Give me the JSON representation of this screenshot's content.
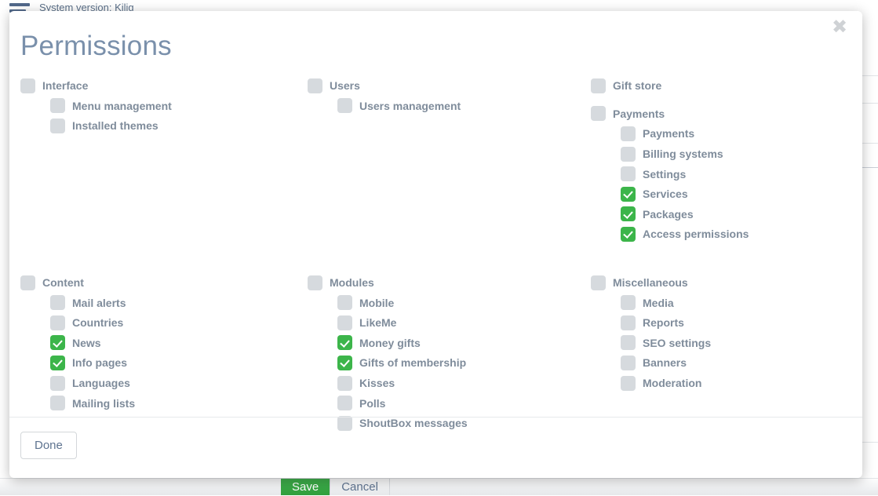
{
  "background": {
    "system_version_text": "System version: Kilig",
    "menu_icon": "hamburger-icon",
    "save_label": "Save",
    "cancel_label": "Cancel"
  },
  "modal": {
    "title": "Permissions",
    "close_icon": "✖",
    "done_label": "Done",
    "accent_checked_color": "#3cb54a",
    "unchecked_color": "#d6dade",
    "label_color": "#7f8c9b",
    "title_color": "#7a90ab",
    "groups": [
      {
        "name": "interface",
        "parent": {
          "label": "Interface",
          "checked": false
        },
        "children": [
          {
            "label": "Menu management",
            "checked": false
          },
          {
            "label": "Installed themes",
            "checked": false
          }
        ]
      },
      {
        "name": "users",
        "parent": {
          "label": "Users",
          "checked": false
        },
        "children": [
          {
            "label": "Users management",
            "checked": false
          }
        ]
      },
      {
        "name": "gift-store-and-payments",
        "parent": {
          "label": "Gift store",
          "checked": false
        },
        "secondary_parent": {
          "label": "Payments",
          "checked": false
        },
        "children": [
          {
            "label": "Payments",
            "checked": false
          },
          {
            "label": "Billing systems",
            "checked": false
          },
          {
            "label": "Settings",
            "checked": false
          },
          {
            "label": "Services",
            "checked": true
          },
          {
            "label": "Packages",
            "checked": true
          },
          {
            "label": "Access permissions",
            "checked": true
          }
        ]
      },
      {
        "name": "content",
        "parent": {
          "label": "Content",
          "checked": false
        },
        "children": [
          {
            "label": "Mail alerts",
            "checked": false
          },
          {
            "label": "Countries",
            "checked": false
          },
          {
            "label": "News",
            "checked": true
          },
          {
            "label": "Info pages",
            "checked": true
          },
          {
            "label": "Languages",
            "checked": false
          },
          {
            "label": "Mailing lists",
            "checked": false
          }
        ]
      },
      {
        "name": "modules",
        "parent": {
          "label": "Modules",
          "checked": false
        },
        "children": [
          {
            "label": "Mobile",
            "checked": false
          },
          {
            "label": "LikeMe",
            "checked": false
          },
          {
            "label": "Money gifts",
            "checked": true
          },
          {
            "label": "Gifts of membership",
            "checked": true
          },
          {
            "label": "Kisses",
            "checked": false
          },
          {
            "label": "Polls",
            "checked": false
          },
          {
            "label": "ShoutBox messages",
            "checked": false
          }
        ]
      },
      {
        "name": "miscellaneous",
        "parent": {
          "label": "Miscellaneous",
          "checked": false
        },
        "children": [
          {
            "label": "Media",
            "checked": false
          },
          {
            "label": "Reports",
            "checked": false
          },
          {
            "label": "SEO settings",
            "checked": false
          },
          {
            "label": "Banners",
            "checked": false
          },
          {
            "label": "Moderation",
            "checked": false
          }
        ]
      }
    ]
  }
}
